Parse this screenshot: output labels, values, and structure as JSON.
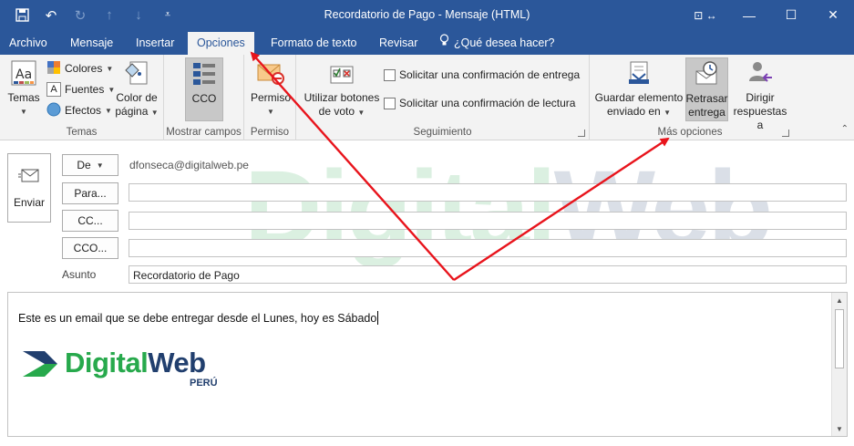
{
  "window": {
    "title": "Recordatorio de Pago - Mensaje (HTML)"
  },
  "tabs": [
    {
      "label": "Archivo"
    },
    {
      "label": "Mensaje"
    },
    {
      "label": "Insertar"
    },
    {
      "label": "Opciones",
      "active": true
    },
    {
      "label": "Formato de texto"
    },
    {
      "label": "Revisar"
    },
    {
      "label": "¿Qué desea hacer?"
    }
  ],
  "ribbon": {
    "temas": {
      "group_label": "Temas",
      "temas_label": "Temas",
      "colores_label": "Colores",
      "fuentes_label": "Fuentes",
      "efectos_label": "Efectos",
      "color_line1": "Color de",
      "color_line2": "página"
    },
    "mostrar": {
      "group_label": "Mostrar campos",
      "cco_label": "CCO"
    },
    "permiso": {
      "group_label": "Permiso",
      "permiso_label": "Permiso"
    },
    "seguimiento": {
      "group_label": "Seguimiento",
      "voto_line1": "Utilizar botones",
      "voto_line2": "de voto",
      "entrega_label": "Solicitar una confirmación de entrega",
      "lectura_label": "Solicitar una confirmación de lectura"
    },
    "mas_opciones": {
      "group_label": "Más opciones",
      "guardar_line1": "Guardar elemento",
      "guardar_line2": "enviado en",
      "retrasar_line1": "Retrasar",
      "retrasar_line2": "entrega",
      "dirigir_line1": "Dirigir",
      "dirigir_line2": "respuestas a"
    }
  },
  "compose": {
    "send_label": "Enviar",
    "from_button": "De",
    "from_value": "dfonseca@digitalweb.pe",
    "to_button": "Para...",
    "cc_button": "CC...",
    "cco_button": "CCO...",
    "subject_label": "Asunto",
    "subject_value": "Recordatorio de Pago",
    "body_text": "Este es un email que se debe entregar desde el Lunes, hoy es Sábado",
    "logo": {
      "part1": "Digital",
      "part2": "Web",
      "country": "PERÚ"
    }
  },
  "watermark": {
    "part1": "Digital",
    "part2": "Web"
  },
  "colors": {
    "accent": "#2b579a",
    "arrow": "#e8141c",
    "logo_green": "#27a94c",
    "logo_navy": "#213f6e"
  }
}
